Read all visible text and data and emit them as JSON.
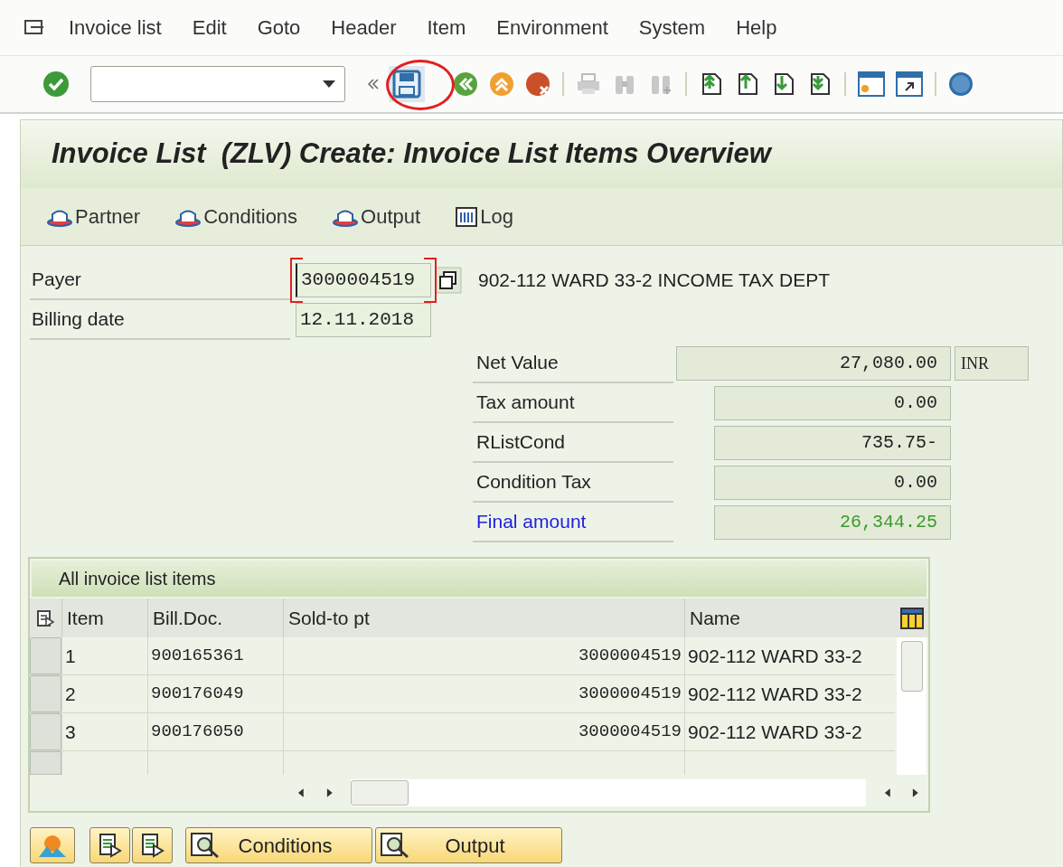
{
  "menu": [
    "Invoice list",
    "Edit",
    "Goto",
    "Header",
    "Item",
    "Environment",
    "System",
    "Help"
  ],
  "toolbar": {
    "save_circled": true
  },
  "title": "Invoice List  (ZLV) Create: Invoice List Items Overview",
  "app_toolbar": [
    {
      "label": "Partner",
      "kind": "hat"
    },
    {
      "label": "Conditions",
      "kind": "hat"
    },
    {
      "label": "Output",
      "kind": "hat"
    },
    {
      "label": "Log",
      "kind": "log"
    }
  ],
  "header_fields": [
    {
      "label": "Payer",
      "value": "3000004519",
      "focused": true,
      "description": "902-112 WARD 33-2 INCOME TAX DEPT"
    },
    {
      "label": "Billing date",
      "value": "12.11.2018",
      "focused": false
    }
  ],
  "totals": [
    {
      "label": "Net Value",
      "value": "27,080.00",
      "currency": "INR",
      "emphasis": false
    },
    {
      "label": "Tax amount",
      "value": "0.00",
      "emphasis": false
    },
    {
      "label": "RListCond",
      "value": "735.75-",
      "emphasis": false
    },
    {
      "label": "Condition Tax",
      "value": "0.00",
      "emphasis": false
    },
    {
      "label": "Final amount",
      "value": "26,344.25",
      "emphasis": true
    }
  ],
  "table": {
    "title": "All invoice list items",
    "columns": [
      "Item",
      "Bill.Doc.",
      "Sold-to pt",
      "Name"
    ],
    "rows": [
      [
        "1",
        "900165361",
        "3000004519",
        "902-112 WARD 33-2"
      ],
      [
        "2",
        "900176049",
        "3000004519",
        "902-112 WARD 33-2"
      ],
      [
        "3",
        "900176050",
        "3000004519",
        "902-112 WARD 33-2"
      ]
    ]
  },
  "bottom_buttons": [
    {
      "label": "Conditions"
    },
    {
      "label": "Output"
    }
  ]
}
